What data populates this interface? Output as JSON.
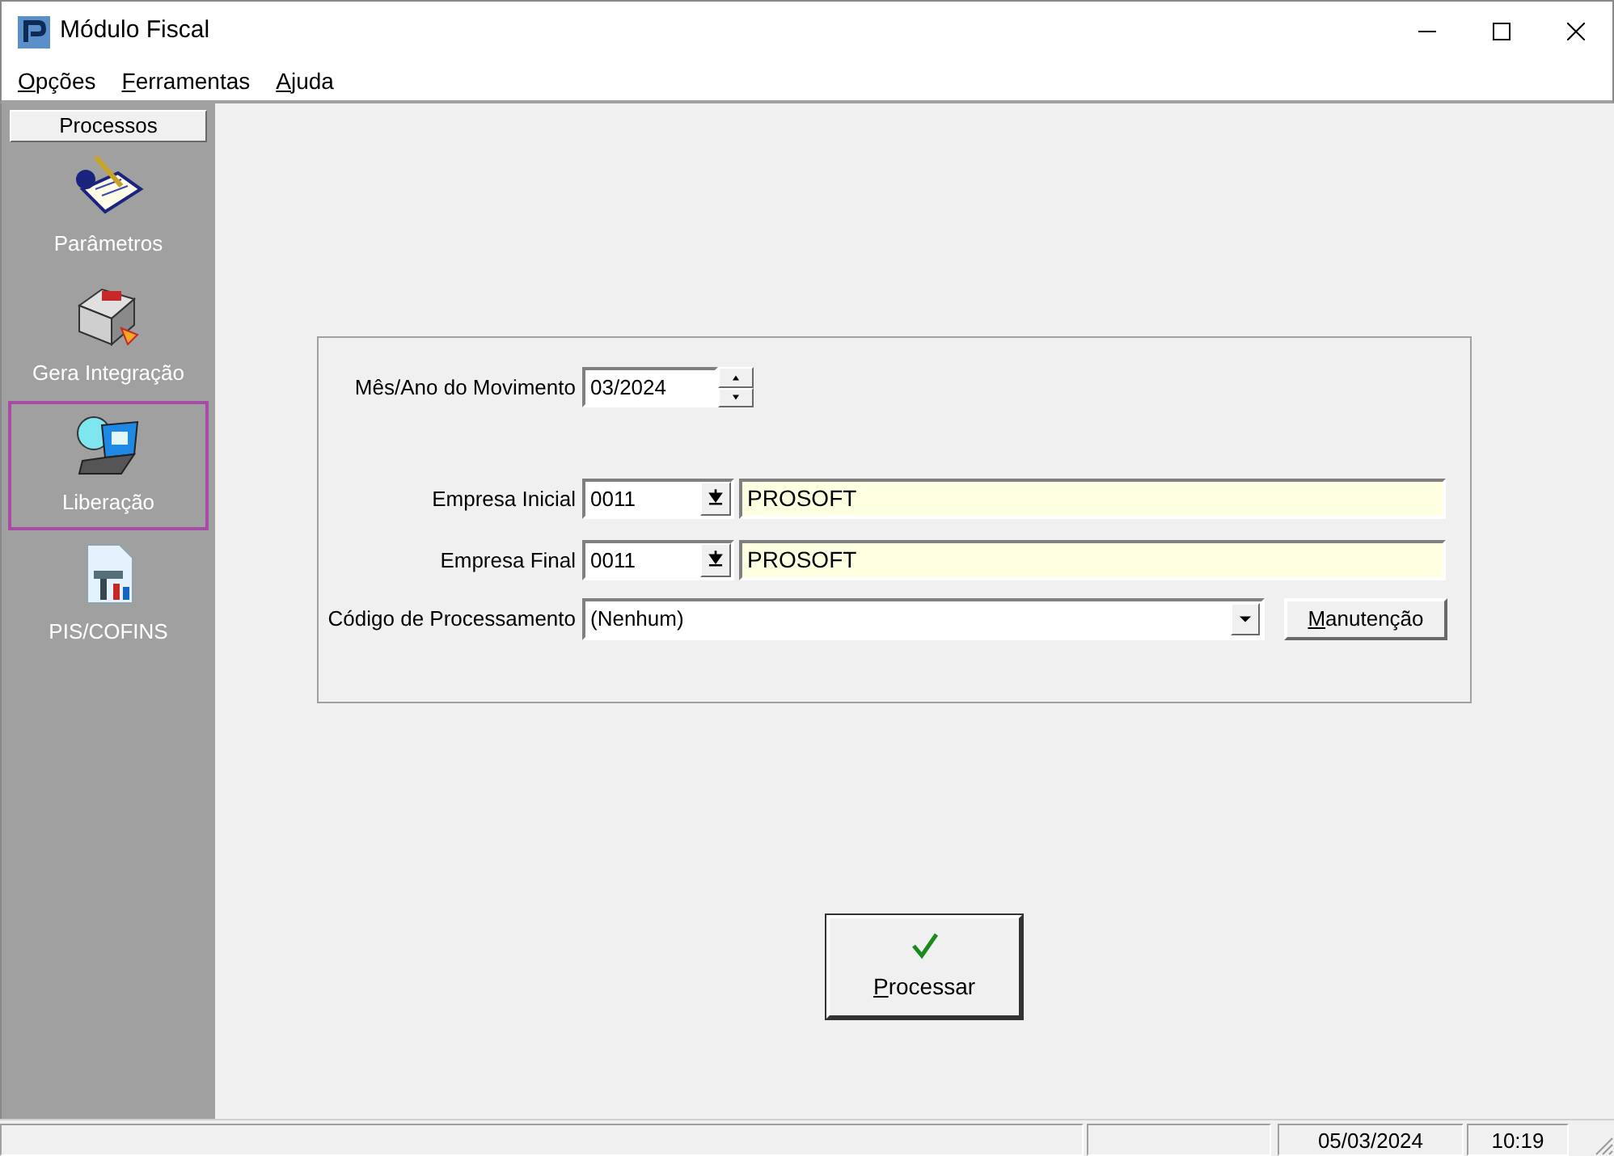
{
  "window": {
    "title": "Módulo Fiscal"
  },
  "menu": [
    {
      "accel": "O",
      "rest": "pções"
    },
    {
      "accel": "F",
      "rest": "erramentas"
    },
    {
      "accel": "A",
      "rest": "juda"
    }
  ],
  "sidebar": {
    "title": "Processos",
    "items": [
      {
        "label": "Parâmetros",
        "kind": "params",
        "selected": false
      },
      {
        "label": "Gera Integração",
        "kind": "integration",
        "selected": false
      },
      {
        "label": "Liberação",
        "kind": "release",
        "selected": true
      },
      {
        "label": "PIS/COFINS",
        "kind": "document",
        "selected": false
      }
    ]
  },
  "form": {
    "period": {
      "label": "Mês/Ano do Movimento",
      "value": "03/2024"
    },
    "companies": [
      {
        "label": "Empresa Inicial",
        "code": "0011",
        "name": "PROSOFT"
      },
      {
        "label": "Empresa Final",
        "code": "0011",
        "name": "PROSOFT"
      }
    ],
    "processing_code": {
      "label": "Código de Processamento",
      "value": "(Nenhum)"
    },
    "maintenance_button": {
      "accel": "M",
      "rest": "anutenção"
    }
  },
  "process_button": {
    "accel": "P",
    "rest": "rocessar"
  },
  "status_bar": {
    "date": "05/03/2024",
    "time": "10:19"
  }
}
